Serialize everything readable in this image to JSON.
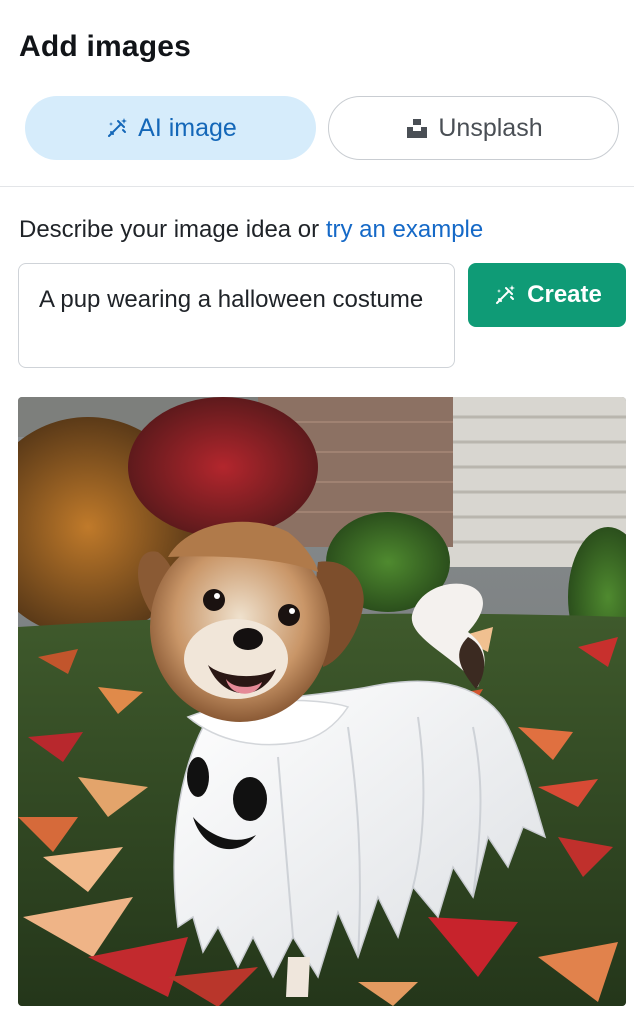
{
  "panel": {
    "title": "Add images"
  },
  "tabs": [
    {
      "label": "AI image",
      "icon": "magic-wand-icon",
      "active": true
    },
    {
      "label": "Unsplash",
      "icon": "unsplash-icon",
      "active": false
    }
  ],
  "prompt": {
    "lead": "Describe your image idea or ",
    "example_link": "try an example",
    "value": "A pup wearing a halloween costume"
  },
  "create_button": {
    "label": "Create",
    "icon": "magic-wand-icon"
  },
  "result_image": {
    "subject": "puppy in ghost costume on autumn leaves"
  },
  "colors": {
    "active_tab_bg": "#d6ecfb",
    "active_tab_text": "#1467b8",
    "link": "#1569c7",
    "create_button": "#0f9b76"
  }
}
